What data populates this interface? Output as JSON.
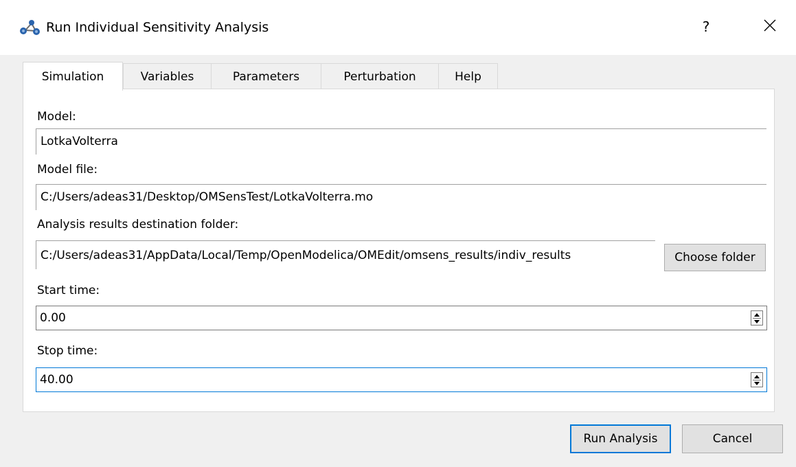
{
  "window": {
    "title": "Run Individual Sensitivity Analysis",
    "help_label": "?",
    "icon": "network-nodes-icon"
  },
  "tabs": [
    {
      "label": "Simulation",
      "active": true
    },
    {
      "label": "Variables",
      "active": false
    },
    {
      "label": "Parameters",
      "active": false
    },
    {
      "label": "Perturbation",
      "active": false
    },
    {
      "label": "Help",
      "active": false
    }
  ],
  "simulation": {
    "model_label": "Model:",
    "model_value": "LotkaVolterra",
    "model_file_label": "Model file:",
    "model_file_value": "C:/Users/adeas31/Desktop/OMSensTest/LotkaVolterra.mo",
    "dest_folder_label": "Analysis results destination folder:",
    "dest_folder_value": "C:/Users/adeas31/AppData/Local/Temp/OpenModelica/OMEdit/omsens_results/indiv_results",
    "choose_folder_label": "Choose folder",
    "start_time_label": "Start time:",
    "start_time_value": "0.00",
    "stop_time_label": "Stop time:",
    "stop_time_value": "40.00"
  },
  "buttons": {
    "run_label": "Run Analysis",
    "cancel_label": "Cancel"
  },
  "colors": {
    "accent": "#0078d7",
    "icon": "#2a64ad"
  }
}
